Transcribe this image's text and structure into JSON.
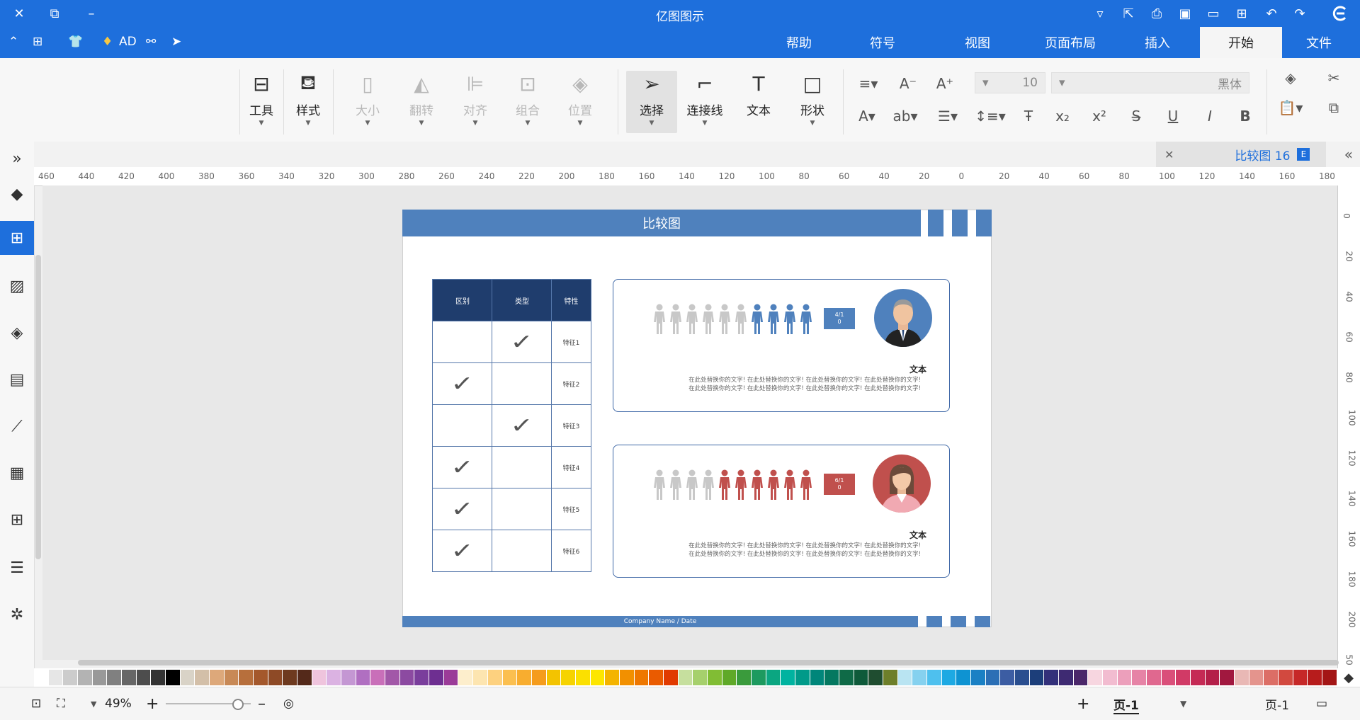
{
  "app": {
    "title": "亿图图示"
  },
  "menu": {
    "tabs": [
      "文件",
      "开始",
      "插入",
      "页面布局",
      "视图",
      "符号",
      "帮助"
    ],
    "active": "开始",
    "ad_label": "AD"
  },
  "ribbon": {
    "font_name": "黑体",
    "font_size": "10",
    "buttons": [
      {
        "label": "形状",
        "icon": "square-icon"
      },
      {
        "label": "文本",
        "icon": "text-t-icon"
      },
      {
        "label": "连接线",
        "icon": "connector-icon"
      },
      {
        "label": "选择",
        "icon": "pointer-icon"
      },
      {
        "label": "位置",
        "icon": "layers-icon"
      },
      {
        "label": "组合",
        "icon": "group-icon"
      },
      {
        "label": "对齐",
        "icon": "align-icon"
      },
      {
        "label": "翻转",
        "icon": "flip-icon"
      },
      {
        "label": "大小",
        "icon": "size-icon"
      },
      {
        "label": "样式",
        "icon": "paint-bucket-icon"
      },
      {
        "label": "工具",
        "icon": "tools-icon"
      }
    ]
  },
  "document": {
    "tab_name": "比较图 16"
  },
  "ruler": {
    "h_labels": [
      "180",
      "160",
      "140",
      "120",
      "100",
      "80",
      "60",
      "40",
      "20",
      "0",
      "20",
      "40",
      "60",
      "80",
      "100",
      "120",
      "140",
      "160",
      "180",
      "200",
      "220",
      "240",
      "260",
      "280",
      "300",
      "320",
      "340",
      "360",
      "380",
      "400",
      "420",
      "440",
      "460"
    ],
    "v_labels": [
      "0",
      "20",
      "40",
      "60",
      "80",
      "100",
      "120",
      "140",
      "160",
      "180",
      "200",
      "50"
    ]
  },
  "page": {
    "header_title": "比较图",
    "footer_text": "Company Name / Date",
    "table": {
      "headers": [
        "特性",
        "类型",
        "区别"
      ],
      "rows": [
        {
          "label": "特征1",
          "col2": true,
          "col3": false
        },
        {
          "label": "特征2",
          "col2": false,
          "col3": true
        },
        {
          "label": "特征3",
          "col2": true,
          "col3": false
        },
        {
          "label": "特征4",
          "col2": false,
          "col3": true
        },
        {
          "label": "特征5",
          "col2": false,
          "col3": true
        },
        {
          "label": "特征6",
          "col2": false,
          "col3": true
        }
      ]
    },
    "cards": [
      {
        "title": "文本",
        "ratio_line1": "4/1",
        "ratio_line2": "0",
        "accent": "#4f81bd",
        "highlighted": 4,
        "total": 10,
        "body_line1": "在此处替换你的文字! 在此处替换你的文字! 在此处替换你的文字! 在此处替换你的文字!",
        "body_line2": "在此处替换你的文字! 在此处替换你的文字! 在此处替换你的文字! 在此处替换你的文字!"
      },
      {
        "title": "文本",
        "ratio_line1": "6/1",
        "ratio_line2": "0",
        "accent": "#c0504d",
        "highlighted": 6,
        "total": 10,
        "body_line1": "在此处替换你的文字! 在此处替换你的文字! 在此处替换你的文字! 在此处替换你的文字!",
        "body_line2": "在此处替换你的文字! 在此处替换你的文字! 在此处替换你的文字! 在此处替换你的文字!"
      }
    ]
  },
  "statusbar": {
    "page_label": "页-1",
    "page_tab": "页-1",
    "zoom": "49%"
  },
  "colors": {
    "brand": "#1e6fdc",
    "header_blue": "#4f81bd",
    "table_head": "#1f3d6d"
  },
  "palette": [
    "#ffffff",
    "#e6e6e6",
    "#cccccc",
    "#b3b3b3",
    "#999999",
    "#808080",
    "#666666",
    "#4d4d4d",
    "#333333",
    "#000000",
    "#d9d3c7",
    "#d3bfa8",
    "#dda87a",
    "#c88956",
    "#b76f3c",
    "#a4582c",
    "#8e4a26",
    "#6e3a1f",
    "#54291a",
    "#efc4dd",
    "#dbb2e2",
    "#c497d3",
    "#b06fc1",
    "#c96fb9",
    "#a258a8",
    "#8c4aa1",
    "#7a3e9c",
    "#6e2f91",
    "#9b3b98",
    "#fdeecc",
    "#fde5b0",
    "#fdd17f",
    "#fbbf4f",
    "#f8ad2f",
    "#f59c1c",
    "#f3c300",
    "#f6d300",
    "#fbe000",
    "#fde600",
    "#f4b400",
    "#f29000",
    "#ee7700",
    "#ea5b00",
    "#e13a00",
    "#c6df9e",
    "#a6d06c",
    "#81bd34",
    "#5fa928",
    "#3a9b3c",
    "#1d9a5f",
    "#0ba681",
    "#00b3a0",
    "#009a89",
    "#00867a",
    "#047860",
    "#0f6a47",
    "#0e5a3a",
    "#1f4d30",
    "#6e7f2a",
    "#b9e4f2",
    "#85d1ef",
    "#4ec0ee",
    "#1da9e3",
    "#0e93d2",
    "#1a80c4",
    "#2b6fb5",
    "#3c5da3",
    "#2a4e8f",
    "#1c3e7a",
    "#33307a",
    "#3e2a72",
    "#4b276a",
    "#f7d6e0",
    "#f2bcd0",
    "#ec9fbb",
    "#e683a6",
    "#e0688f",
    "#da4f7a",
    "#d13a66",
    "#c52a55",
    "#b41f49",
    "#a1183f",
    "#e9b8b5",
    "#e4948d",
    "#dc6e66",
    "#d2493f",
    "#c62828",
    "#b71c1c",
    "#a31515"
  ]
}
